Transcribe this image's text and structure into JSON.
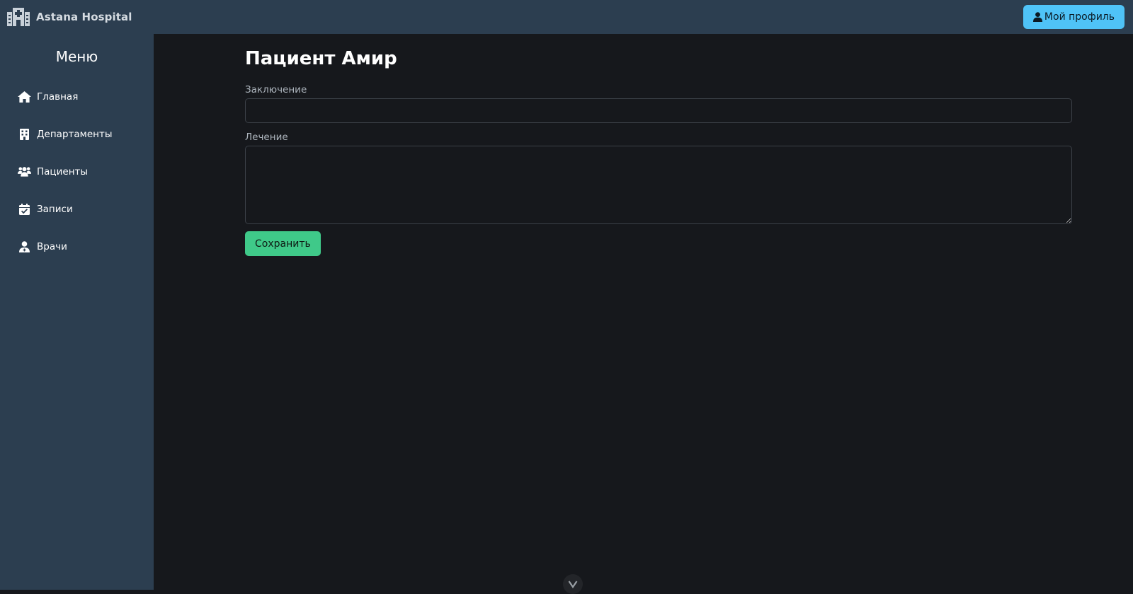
{
  "header": {
    "brand": "Astana Hospital",
    "brand_icon": "hospital-icon",
    "profile_button": "Мой профиль",
    "profile_icon": "user-icon"
  },
  "sidebar": {
    "title": "Меню",
    "items": [
      {
        "label": "Главная",
        "icon": "home-icon"
      },
      {
        "label": "Департаменты",
        "icon": "building-icon"
      },
      {
        "label": "Пациенты",
        "icon": "users-icon"
      },
      {
        "label": "Записи",
        "icon": "calendar-check-icon"
      },
      {
        "label": "Врачи",
        "icon": "doctor-icon"
      }
    ]
  },
  "main": {
    "title": "Пациент Амир",
    "conclusion_label": "Заключение",
    "conclusion_value": "",
    "treatment_label": "Лечение",
    "treatment_value": "",
    "save_button": "Сохранить",
    "scroll_icon": "chevron-down-icon"
  },
  "colors": {
    "topbar": "#2c3e50",
    "sidebar": "#2c3e50",
    "main_bg": "#16181c",
    "profile_button": "#4fc3f7",
    "save_button": "#3fc989"
  }
}
